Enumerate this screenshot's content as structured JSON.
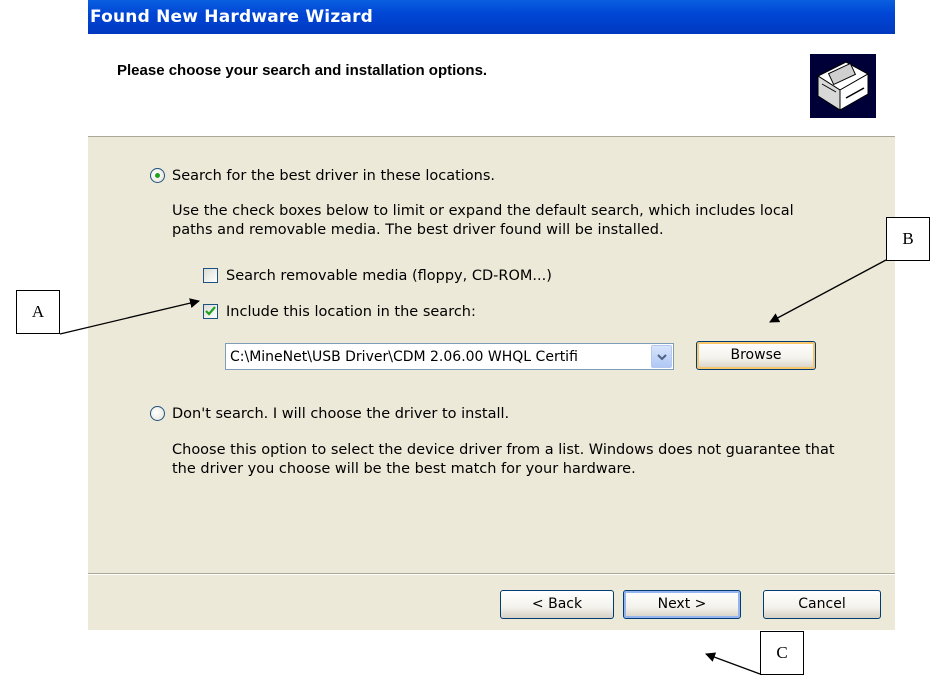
{
  "window": {
    "title": "Found New Hardware Wizard"
  },
  "header": {
    "heading": "Please choose your search and installation options.",
    "icon": "hardware-install-icon"
  },
  "search_option": {
    "label": "Search for the best driver in these locations.",
    "selected": true,
    "description_line1": "Use the check boxes below to limit or expand the default search, which includes local",
    "description_line2": "paths and removable media. The best driver found will be installed.",
    "removable_media": {
      "label": "Search removable media (floppy, CD-ROM...)",
      "checked": false
    },
    "include_location": {
      "label": "Include this location in the search:",
      "checked": true
    },
    "location_path": "C:\\MineNet\\USB Driver\\CDM 2.06.00 WHQL Certifi",
    "browse_label": "Browse"
  },
  "manual_option": {
    "label": "Don't search. I will choose the driver to install.",
    "selected": false,
    "description_line1": "Choose this option to select the device driver from a list.  Windows does not guarantee that",
    "description_line2": "the driver you choose will be the best match for your hardware."
  },
  "buttons": {
    "back": "< Back",
    "next": "Next >",
    "cancel": "Cancel"
  },
  "callouts": {
    "a": "A",
    "b": "B",
    "c": "C"
  },
  "colors": {
    "titlebar": "#0046d5",
    "dialog_bg": "#ece9d8",
    "radio_dot": "#21a121",
    "check": "#21a121"
  }
}
